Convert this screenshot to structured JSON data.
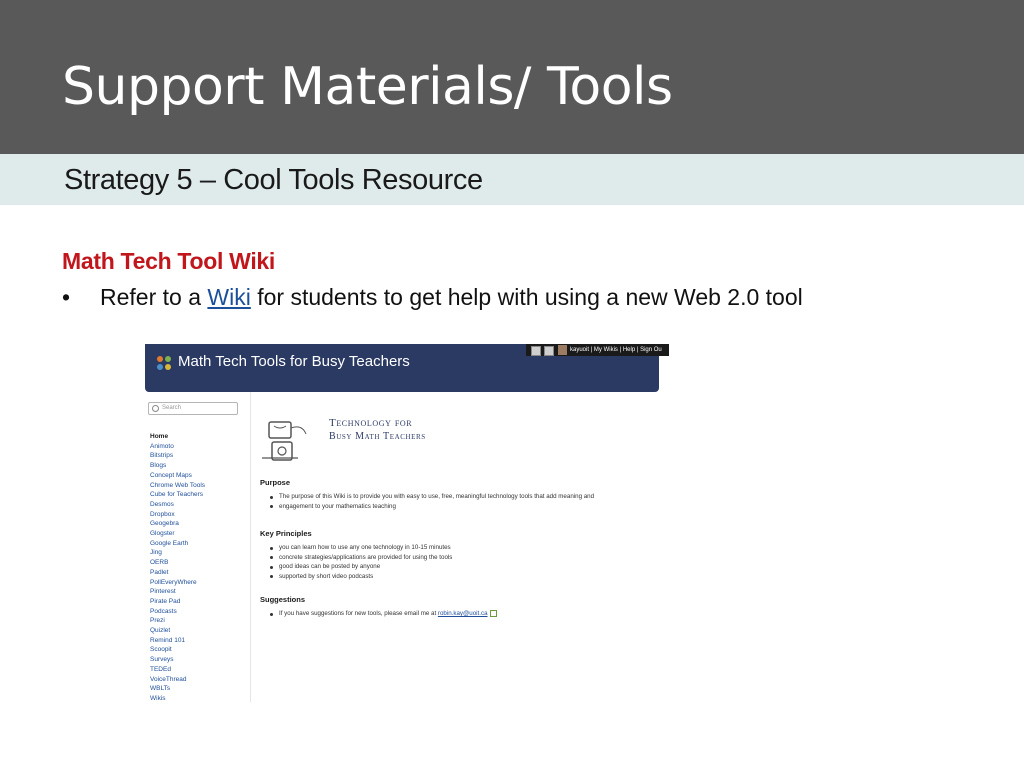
{
  "slide": {
    "title": "Support Materials/ Tools",
    "subtitle": "Strategy 5 – Cool Tools Resource",
    "heading": "Math Tech Tool Wiki",
    "bullet": {
      "marker": "•",
      "before": "Refer to a ",
      "link": "Wiki",
      "after": " for students to get help with using a new Web 2.0  tool"
    }
  },
  "wiki": {
    "site_title": "Math Tech Tools for Busy Teachers",
    "topbar": {
      "user": "kayuoit",
      "my_wikis": "My Wikis",
      "help": "Help",
      "sign_out": "Sign Ou",
      "separator": "|"
    },
    "search_placeholder": "Search",
    "nav_items": [
      "Home",
      "Animoto",
      "Bitstrips",
      "Blogs",
      "Concept Maps",
      "Chrome Web Tools",
      "Cube for Teachers",
      "Desmos",
      "Dropbox",
      "Geogebra",
      "Glogster",
      "Google Earth",
      "Jing",
      "OERB",
      "Padlet",
      "PollEveryWhere",
      "Pinterest",
      "Pirate Pad",
      "Podcasts",
      "Prezi",
      "Quizlet",
      "Remind 101",
      "Scoopit",
      "Surveys",
      "TEDEd",
      "VoiceThread",
      "WBLTs",
      "Wikis"
    ],
    "banner": {
      "line1": "Technology for",
      "line2": "Busy Math Teachers"
    },
    "purpose": {
      "title": "Purpose",
      "items": [
        "The purpose of this Wiki is to provide you with easy to use, free, meaningful technology tools that add meaning and",
        "engagement to your mathematics teaching"
      ]
    },
    "key_principles": {
      "title": "Key Principles",
      "items": [
        "you can learn how to use any one technology in 10-15 minutes",
        "concrete strategies/applications are provided for using the tools",
        "good ideas can be posted by anyone",
        "supported by short video podcasts"
      ]
    },
    "suggestions": {
      "title": "Suggestions",
      "text": "If you have suggestions for new tools, please email me at ",
      "email": "robin.kay@uoit.ca"
    }
  },
  "colors": {
    "title_bar": "#595959",
    "subtitle_bar": "#dfebeb",
    "heading": "#c0161c",
    "link": "#1a4f9c",
    "wiki_header": "#2b3a63"
  }
}
